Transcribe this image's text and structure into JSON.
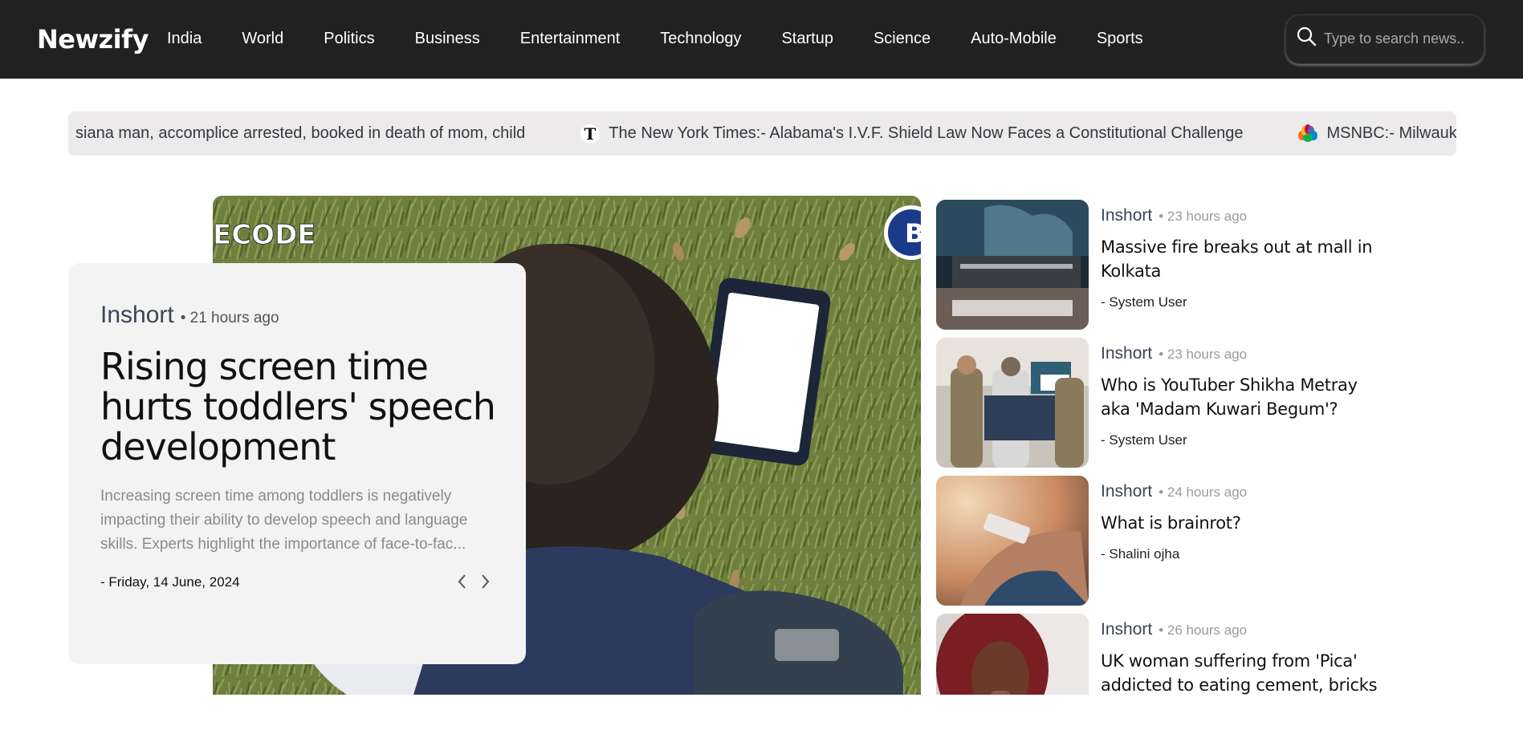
{
  "header": {
    "logo": "Newzify",
    "nav": [
      "India",
      "World",
      "Politics",
      "Business",
      "Entertainment",
      "Technology",
      "Startup",
      "Science",
      "Auto-Mobile",
      "Sports"
    ],
    "search_placeholder": "Type to search news.."
  },
  "ticker": {
    "items": [
      {
        "icon": "none",
        "text": "siana man, accomplice arrested, booked in death of mom, child"
      },
      {
        "icon": "nyt-logo-icon",
        "text": "The New York Times:- Alabama's I.V.F. Shield Law Now Faces a Constitutional Challenge"
      },
      {
        "icon": "msnbc-peacock-icon",
        "text": "MSNBC:- Milwauk"
      }
    ]
  },
  "hero": {
    "source": "Inshort",
    "time": "• 21 hours ago",
    "title": "Rising screen time hurts toddlers' speech development",
    "description": "Increasing screen time among toddlers is negatively impacting their ability to develop speech and language skills. Experts highlight the importance of face-to-fac...",
    "date": "- Friday, 14 June, 2024",
    "image_overlay_text": "ECODE",
    "image_badge_text": "B"
  },
  "side_news": [
    {
      "source": "Inshort",
      "time": "• 23 hours ago",
      "title": "Massive fire breaks out at mall in Kolkata",
      "author": "- System User"
    },
    {
      "source": "Inshort",
      "time": "• 23 hours ago",
      "title": "Who is YouTuber Shikha Metray aka 'Madam Kuwari Begum'?",
      "author": "- System User"
    },
    {
      "source": "Inshort",
      "time": "• 24 hours ago",
      "title": "What is brainrot?",
      "author": "- Shalini ojha"
    },
    {
      "source": "Inshort",
      "time": "• 26 hours ago",
      "title": "UK woman suffering from 'Pica' addicted to eating cement, bricks",
      "author": ""
    }
  ],
  "colors": {
    "header_bg": "#212121",
    "ticker_bg": "#eceaea",
    "card_bg": "#f3f3f3",
    "source_text": "#3a4556"
  }
}
